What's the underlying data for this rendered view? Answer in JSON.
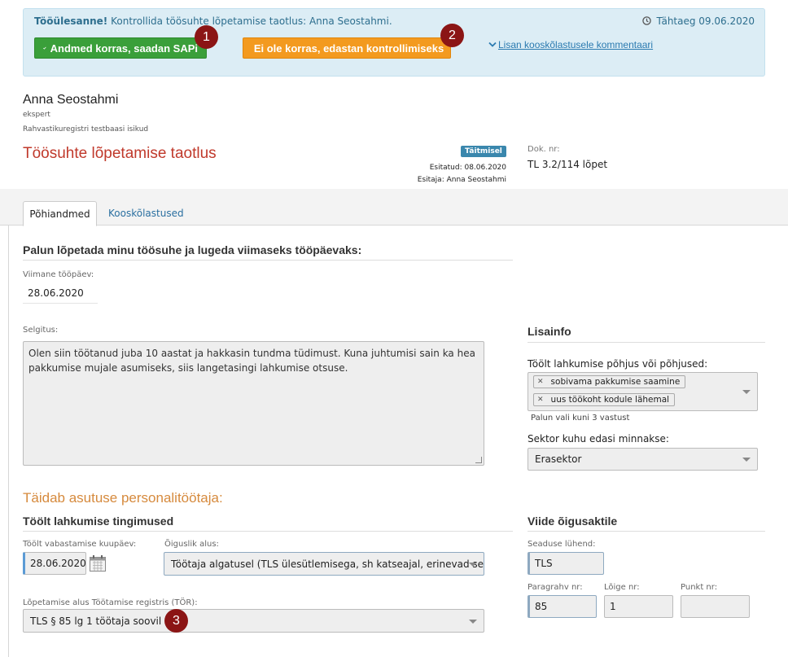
{
  "task_banner": {
    "label": "Tööülesanne!",
    "text": "Kontrollida töösuhte lõpetamise taotlus: Anna Seostahmi.",
    "deadline": "Tähtaeg 09.06.2020",
    "approve_button": "Andmed korras, saadan SAPi",
    "reject_button": "Ei ole korras, edastan kontrollimiseks",
    "comment_link": "Lisan kooskõlastusele kommentaari"
  },
  "markers": [
    "1",
    "2",
    "3"
  ],
  "person": {
    "name": "Anna Seostahmi",
    "role": "ekspert",
    "organization": "Rahvastikuregistri testbaasi isikud"
  },
  "document": {
    "title": "Töösuhte lõpetamise taotlus",
    "status": "Täitmisel",
    "submitted": "Esitatud: 08.06.2020",
    "submitter": "Esitaja: Anna Seostahmi",
    "doc_nr_label": "Dok. nr:",
    "doc_nr": "TL 3.2/114 lõpet"
  },
  "tabs": [
    "Põhiandmed",
    "Kooskõlastused"
  ],
  "request": {
    "heading": "Palun lõpetada minu töösuhe ja lugeda viimaseks tööpäevaks:",
    "last_day_label": "Viimane tööpäev:",
    "last_day": "28.06.2020",
    "explanation_label": "Selgitus:",
    "explanation": "Olen siin töötanud juba 10 aastat ja hakkasin tundma tüdimust. Kuna juhtumisi sain ka hea pakkumise mujale asumiseks, siis langetasingi lahkumise otsuse."
  },
  "extra_info": {
    "heading": "Lisainfo",
    "reasons_label": "Töölt lahkumise põhjus või põhjused:",
    "reasons": [
      "sobivama pakkumise saamine",
      "uus töökoht kodule lähemal"
    ],
    "reasons_hint": "Palun vali kuni 3 vastust",
    "sector_label": "Sektor kuhu edasi minnakse:",
    "sector": "Erasektor"
  },
  "hr_section": {
    "heading": "Täidab asutuse personalitöötaja:",
    "conditions_heading": "Töölt lahkumise tingimused",
    "release_date_label": "Töölt vabastamise kuupäev:",
    "release_date": "28.06.2020",
    "legal_basis_label": "Õiguslik alus:",
    "legal_basis": "Töötaja algatusel (TLS ülesütlemisega, sh katseajal, erinevad sea...",
    "tor_label": "Lõpetamise alus Töötamise registris (TÖR):",
    "tor": "TLS § 85 lg 1 töötaja soovil"
  },
  "law_ref": {
    "heading": "Viide õigusaktile",
    "act_label": "Seaduse lühend:",
    "act": "TLS",
    "paragraph_label": "Paragrahv nr:",
    "paragraph": "85",
    "section_label": "Lõige nr:",
    "section": "1",
    "point_label": "Punkt nr:",
    "point": ""
  },
  "colors": {
    "banner_bg": "#dcedf5",
    "approve": "#3a9f3a",
    "reject": "#f39a1f",
    "title": "#c0392b",
    "status": "#3a87ad",
    "marker": "#8b1515"
  }
}
